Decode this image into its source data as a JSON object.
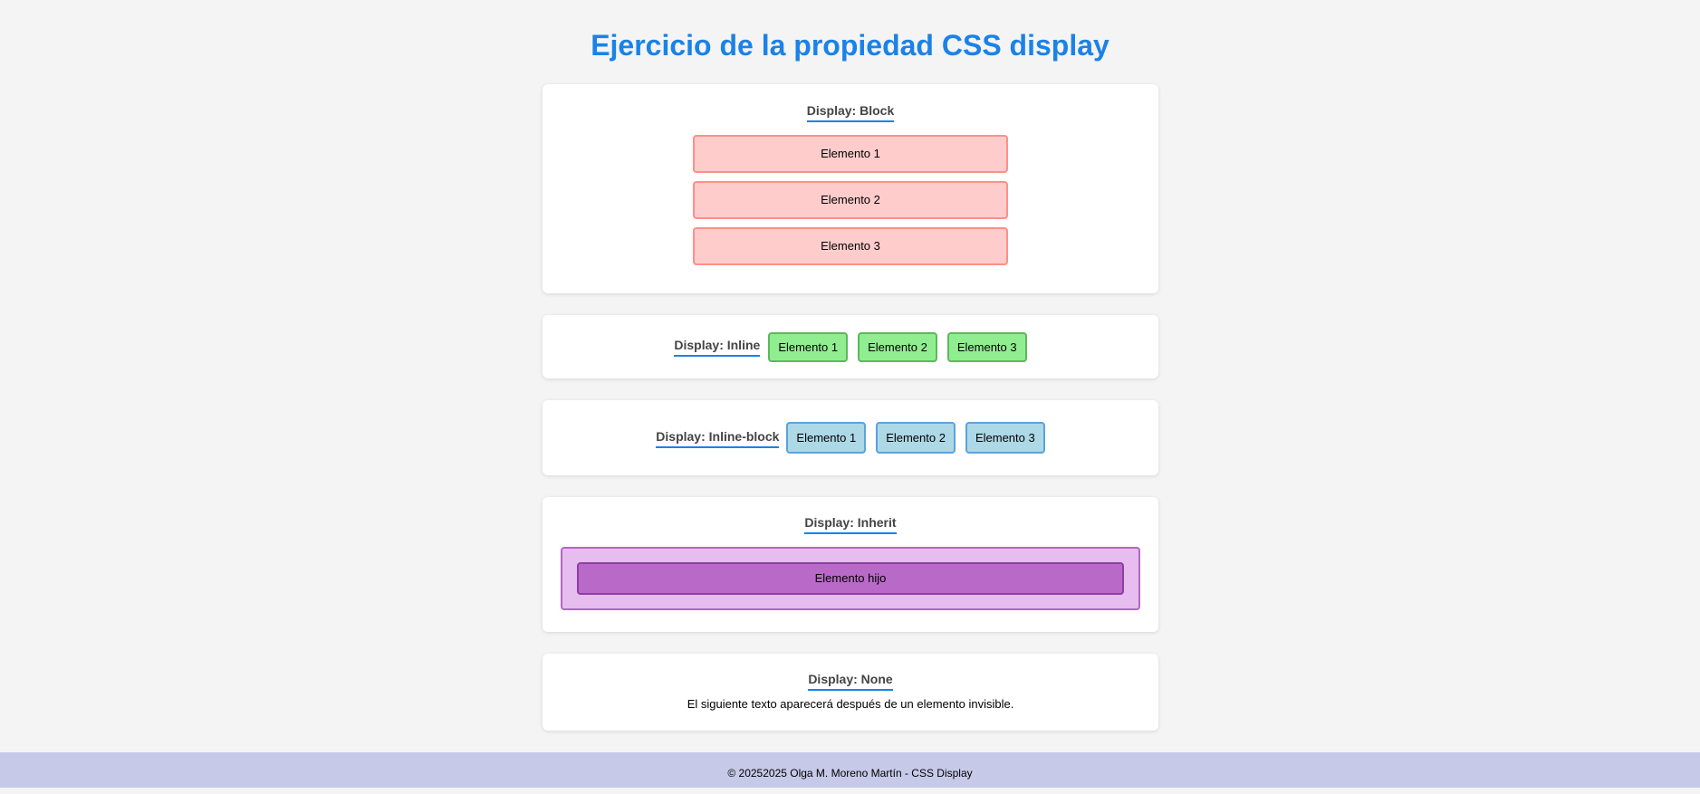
{
  "page": {
    "title": "Ejercicio de la propiedad CSS display"
  },
  "block": {
    "title": "Display: Block",
    "items": [
      "Elemento 1",
      "Elemento 2",
      "Elemento 3"
    ]
  },
  "inline": {
    "title": "Display: Inline",
    "items": [
      "Elemento 1",
      "Elemento 2",
      "Elemento 3"
    ]
  },
  "inline_block": {
    "title": "Display: Inline-block",
    "items": [
      "Elemento 1",
      "Elemento 2",
      "Elemento 3"
    ]
  },
  "inherit": {
    "title": "Display: Inherit",
    "child": "Elemento hijo"
  },
  "none": {
    "title": "Display: None",
    "text": "El siguiente texto aparecerá después de un elemento invisible."
  },
  "footer": {
    "text": "© 20252025 Olga M. Moreno Martín - CSS Display"
  },
  "colors": {
    "accent": "#1a82e8",
    "block_bg": "#ffcccc",
    "inline_bg": "#90ee90",
    "inline_block_bg": "#add8e6",
    "inherit_parent_bg": "#e6bdee",
    "inherit_child_bg": "#b969c7",
    "footer_bg": "#c6c9e8"
  }
}
